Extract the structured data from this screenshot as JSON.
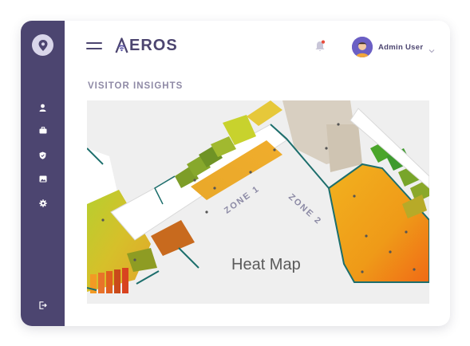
{
  "app": {
    "brand": "EROS",
    "user_name": "Admin User"
  },
  "sidebar": {
    "items": [
      {
        "icon": "user-icon"
      },
      {
        "icon": "briefcase-icon"
      },
      {
        "icon": "shield-icon"
      },
      {
        "icon": "image-icon"
      },
      {
        "icon": "gear-icon"
      }
    ],
    "logout_icon": "logout-icon"
  },
  "main": {
    "section_title": "VISITOR INSIGHTS",
    "map": {
      "title": "Heat Map",
      "zones": [
        "ZONE 1",
        "ZONE 2"
      ]
    }
  },
  "colors": {
    "sidebar": "#4c4570",
    "accent": "#5b55a8",
    "notification": "#e74c3c",
    "heat_orange": "#f0a020",
    "heat_green": "#7bb02c",
    "heat_red": "#d8431f"
  }
}
